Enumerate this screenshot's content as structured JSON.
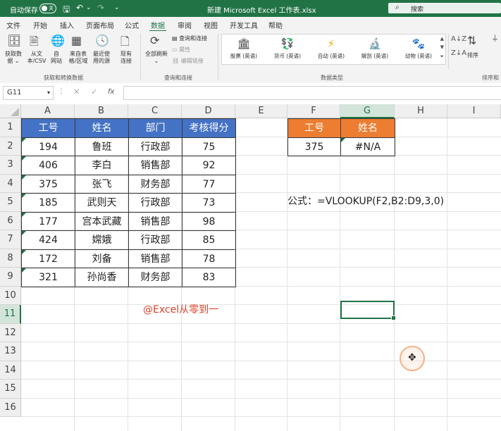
{
  "titlebar": {
    "autosave_label": "自动保存",
    "toggle_state": "关",
    "doc_title": "新建 Microsoft Excel 工作表.xlsx",
    "search_placeholder": "搜索"
  },
  "tabs": [
    "文件",
    "开始",
    "插入",
    "页面布局",
    "公式",
    "数据",
    "审阅",
    "视图",
    "开发工具",
    "帮助"
  ],
  "active_tab": "数据",
  "ribbon": {
    "get_data": [
      "获取数",
      "据"
    ],
    "from_text": [
      "从文",
      "本/CSV"
    ],
    "from_web": [
      "自",
      "网站"
    ],
    "from_table": [
      "来自表",
      "格/区域"
    ],
    "recent_sources": [
      "最近使",
      "用的源"
    ],
    "existing_conn": [
      "现有",
      "连接"
    ],
    "group1": "获取和转换数据",
    "refresh_all": [
      "全部刷新"
    ],
    "queries_conn": "查询和连接",
    "properties": "属性",
    "edit_links": "编辑链接",
    "group2": "查询和连接",
    "data_types": [
      {
        "icon": "🏛",
        "label": "股票 (英语)"
      },
      {
        "icon": "💱",
        "label": "货币 (英语)"
      },
      {
        "icon": "⚡",
        "label": "自动 (英语)"
      },
      {
        "icon": "🔬",
        "label": "解剖 (英语)"
      },
      {
        "icon": "🐾",
        "label": "动物 (英语)"
      }
    ],
    "group3": "数据类型",
    "sort": "排序",
    "group4": "排序和"
  },
  "formula_bar": {
    "name_box": "G11",
    "fx": "fx",
    "content": ""
  },
  "columns": [
    "A",
    "B",
    "C",
    "D",
    "E",
    "F",
    "G",
    "H",
    "I"
  ],
  "rows": [
    "1",
    "2",
    "3",
    "4",
    "5",
    "6",
    "7",
    "8",
    "9",
    "10",
    "11",
    "12",
    "13",
    "14",
    "15",
    "16"
  ],
  "table": {
    "headers": [
      "工号",
      "姓名",
      "部门",
      "考核得分"
    ],
    "rows": [
      [
        "194",
        "鲁班",
        "行政部",
        "75"
      ],
      [
        "406",
        "李白",
        "销售部",
        "92"
      ],
      [
        "375",
        "张飞",
        "财务部",
        "77"
      ],
      [
        "185",
        "武则天",
        "行政部",
        "73"
      ],
      [
        "177",
        "宫本武藏",
        "销售部",
        "98"
      ],
      [
        "424",
        "嫦娥",
        "行政部",
        "85"
      ],
      [
        "172",
        "刘备",
        "销售部",
        "78"
      ],
      [
        "321",
        "孙尚香",
        "财务部",
        "83"
      ]
    ]
  },
  "lookup": {
    "headers": [
      "工号",
      "姓名"
    ],
    "values": [
      "375",
      "#N/A"
    ]
  },
  "formula_note": "公式：=VLOOKUP(F2,B2:D9,3,0)",
  "watermark": "@Excel从零到一",
  "colors": {
    "excel_green": "#217346",
    "header_blue": "#4472c4",
    "header_orange": "#ed7d31",
    "watermark_red": "#d9422b",
    "cursor_ring": "#f4b183"
  },
  "selected_cell": "G11"
}
